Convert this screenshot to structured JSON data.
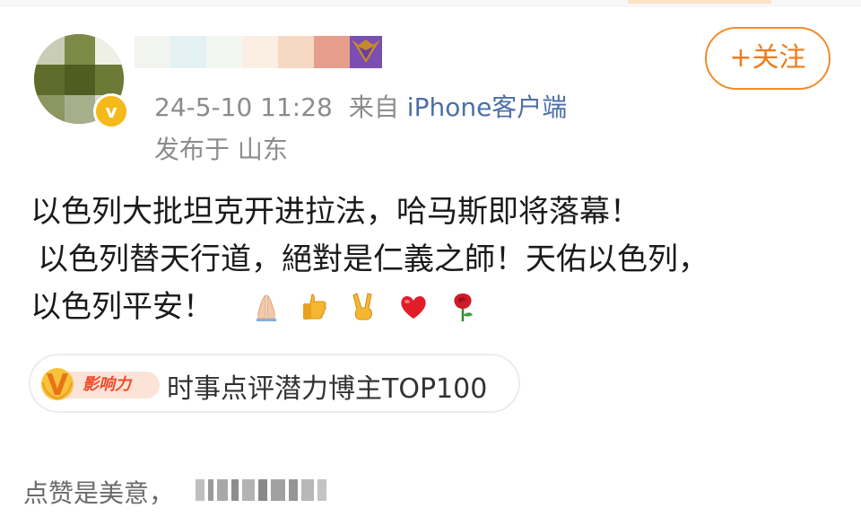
{
  "post": {
    "timestamp": "24-5-10 11:28",
    "source_prefix": "来自",
    "source_app": "iPhone客户端",
    "location": "发布于 山东",
    "verified_mark": "v",
    "follow_label": "+关注",
    "text_lines": [
      "以色列大批坦克开进拉法，哈马斯即将落幕！",
      "以色列替天行道，絕對是仁義之師！天佑以色列，",
      "以色列平安！"
    ],
    "emojis": [
      "folded-hands",
      "thumbs-up",
      "victory-hand",
      "red-heart",
      "rose"
    ]
  },
  "influence": {
    "badge_label": "影响力",
    "text": "时事点评潜力博主TOP100"
  },
  "footer": {
    "prefix": "点赞是美意，"
  },
  "colors": {
    "accent_orange": "#f07a1a",
    "link_blue": "#4c6fa6",
    "meta_gray": "#8c8c8c",
    "verified_gold": "#f6b91a"
  }
}
